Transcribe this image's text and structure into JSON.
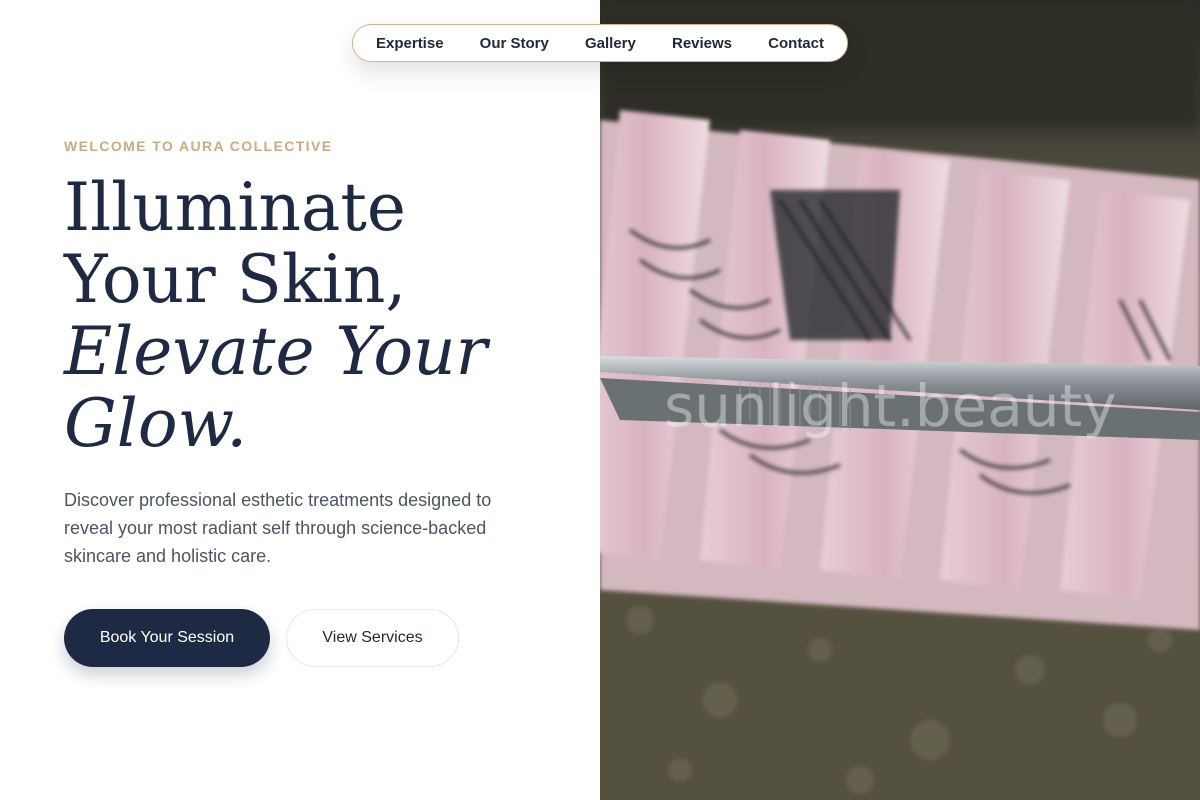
{
  "nav": {
    "items": [
      {
        "label": "Expertise"
      },
      {
        "label": "Our Story"
      },
      {
        "label": "Gallery"
      },
      {
        "label": "Reviews"
      },
      {
        "label": "Contact"
      }
    ]
  },
  "hero": {
    "eyebrow": "WELCOME TO AURA COLLECTIVE",
    "headline": {
      "line1": "Illuminate",
      "line2": "Your Skin,",
      "line3": "Elevate Your",
      "line4": "Glow."
    },
    "description": "Discover professional esthetic treatments designed to reveal your most radiant self through science-backed skincare and holistic care.",
    "primary_button": "Book Your Session",
    "secondary_button": "View Services"
  },
  "image": {
    "watermark": "sunlight.beauty"
  },
  "colors": {
    "accent": "#cfa981",
    "navy": "#1e2a44",
    "nav_border": "#d4b48c"
  }
}
